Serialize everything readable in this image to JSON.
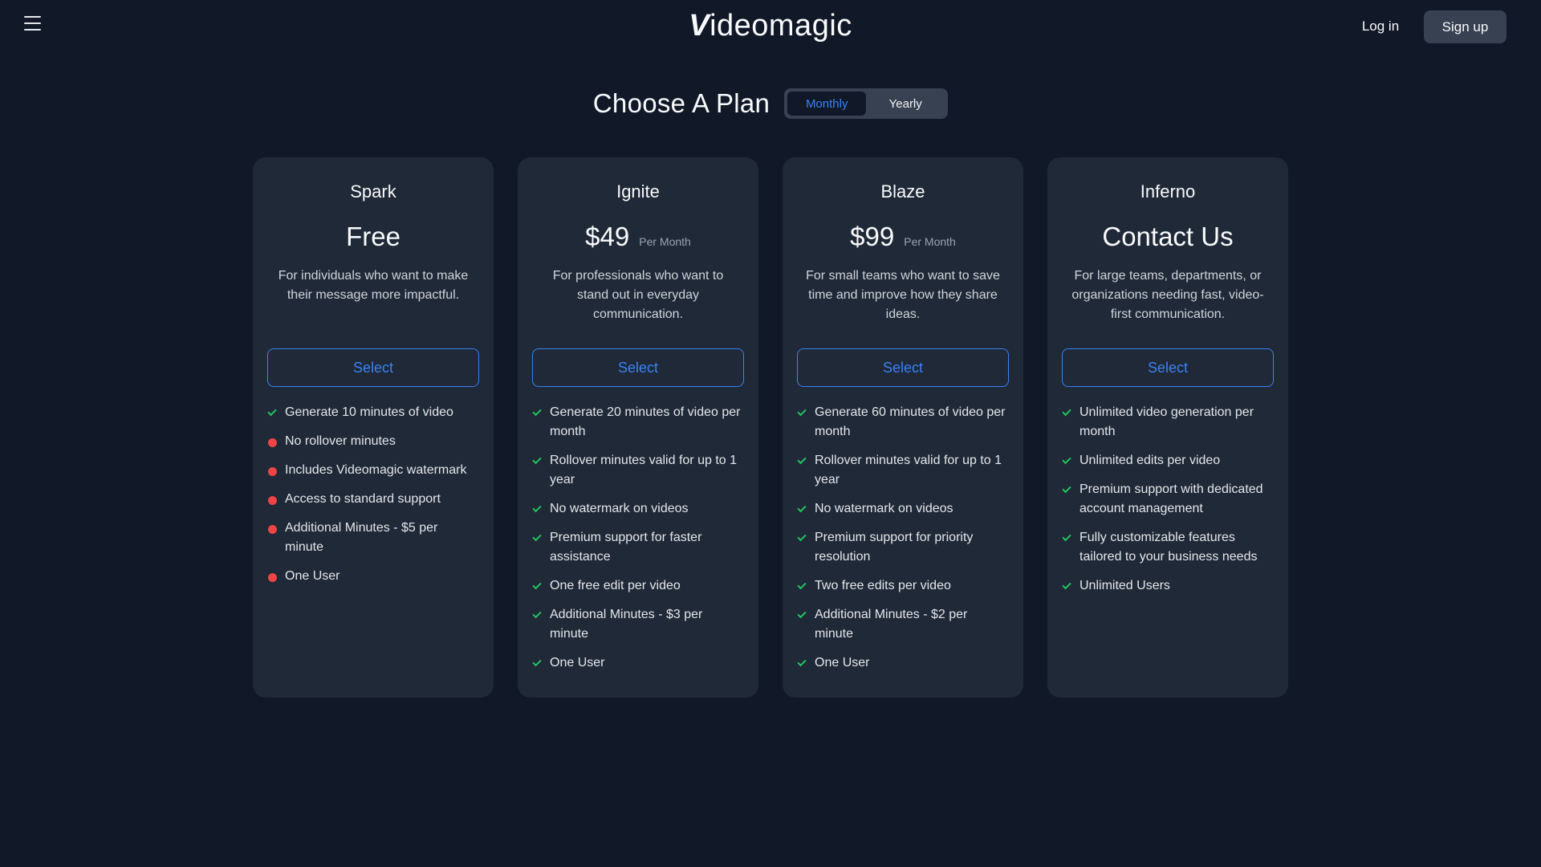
{
  "header": {
    "brand": "ideomagic",
    "brand_mark": "V",
    "login": "Log in",
    "signup": "Sign up"
  },
  "plans_header": {
    "title": "Choose A Plan",
    "toggle": {
      "monthly": "Monthly",
      "yearly": "Yearly",
      "selected": "Monthly"
    }
  },
  "plans": [
    {
      "name": "Spark",
      "price": "Free",
      "per": "",
      "description": "For individuals who want to make their message more impactful.",
      "button": "Select",
      "features": [
        {
          "text": "Generate 10 minutes of video",
          "icon": "check-icon"
        },
        {
          "text": "No rollover minutes",
          "icon": "red-dot-icon"
        },
        {
          "text": "Includes Videomagic watermark",
          "icon": "red-dot-icon"
        },
        {
          "text": "Access to standard support",
          "icon": "red-dot-icon"
        },
        {
          "text": "Additional Minutes - $5 per minute",
          "icon": "red-dot-icon"
        },
        {
          "text": "One User",
          "icon": "red-dot-icon"
        }
      ]
    },
    {
      "name": "Ignite",
      "price": "$49",
      "per": "Per Month",
      "description": "For professionals who want to stand out in everyday communication.",
      "button": "Select",
      "features": [
        {
          "text": "Generate 20 minutes of video per month",
          "icon": "check-icon"
        },
        {
          "text": "Rollover minutes valid for up to 1 year",
          "icon": "check-icon"
        },
        {
          "text": "No watermark on videos",
          "icon": "check-icon"
        },
        {
          "text": "Premium support for faster assistance",
          "icon": "check-icon"
        },
        {
          "text": "One free edit per video",
          "icon": "check-icon"
        },
        {
          "text": "Additional Minutes - $3 per minute",
          "icon": "check-icon"
        },
        {
          "text": "One User",
          "icon": "check-icon"
        }
      ]
    },
    {
      "name": "Blaze",
      "price": "$99",
      "per": "Per Month",
      "description": "For small teams who want to save time and improve how they share ideas.",
      "button": "Select",
      "features": [
        {
          "text": "Generate 60 minutes of video per month",
          "icon": "check-icon"
        },
        {
          "text": "Rollover minutes valid for up to 1 year",
          "icon": "check-icon"
        },
        {
          "text": "No watermark on videos",
          "icon": "check-icon"
        },
        {
          "text": "Premium support for priority resolution",
          "icon": "check-icon"
        },
        {
          "text": "Two free edits per video",
          "icon": "check-icon"
        },
        {
          "text": "Additional Minutes - $2 per minute",
          "icon": "check-icon"
        },
        {
          "text": "One User",
          "icon": "check-icon"
        }
      ]
    },
    {
      "name": "Inferno",
      "price": "Contact Us",
      "per": "",
      "description": "For large teams, departments, or organizations needing fast, video-first communication.",
      "button": "Select",
      "features": [
        {
          "text": "Unlimited video generation per month",
          "icon": "check-icon"
        },
        {
          "text": "Unlimited edits per video",
          "icon": "check-icon"
        },
        {
          "text": "Premium support with dedicated account management",
          "icon": "check-icon"
        },
        {
          "text": "Fully customizable features tailored to your business needs",
          "icon": "check-icon"
        },
        {
          "text": "Unlimited Users",
          "icon": "check-icon"
        }
      ]
    }
  ],
  "colors": {
    "background": "#111827",
    "card": "#1f2937",
    "accent": "#3b82f6",
    "check": "#22c55e",
    "dot": "#ef4444"
  }
}
